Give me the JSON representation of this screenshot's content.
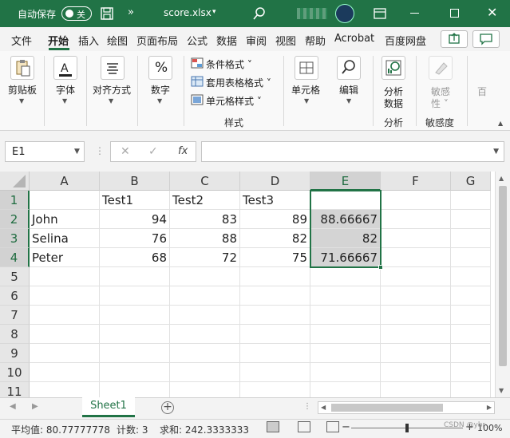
{
  "titlebar": {
    "autosave_label": "自动保存",
    "autosave_state": "关",
    "more": "»",
    "filename": "score.xlsx",
    "caret": "▾"
  },
  "tabs": [
    {
      "label": "文件"
    },
    {
      "label": "开始"
    },
    {
      "label": "插入"
    },
    {
      "label": "绘图"
    },
    {
      "label": "页面布局"
    },
    {
      "label": "公式"
    },
    {
      "label": "数据"
    },
    {
      "label": "审阅"
    },
    {
      "label": "视图"
    },
    {
      "label": "帮助"
    },
    {
      "label": "Acrobat"
    },
    {
      "label": "百度网盘"
    }
  ],
  "ribbon": {
    "clipboard": "剪贴板",
    "font": "字体",
    "align": "对齐方式",
    "number": "数字",
    "cond_format": "条件格式 ˅",
    "table_format": "套用表格格式 ˅",
    "cell_style": "单元格样式 ˅",
    "styles_group": "样式",
    "cells": "单元格",
    "edit": "编辑",
    "analyze_1": "分析",
    "analyze_2": "数据",
    "analyze_group": "分析",
    "sensitivity_1": "敏感",
    "sensitivity_2": "性 ˅",
    "sensitivity_group": "敏感度",
    "number_icon": "%",
    "partial": "百"
  },
  "formula_bar": {
    "name_box": "E1",
    "fx": "fx",
    "value": ""
  },
  "sheet": {
    "columns": [
      "A",
      "B",
      "C",
      "D",
      "E",
      "F",
      "G"
    ],
    "rows": [
      "1",
      "2",
      "3",
      "4",
      "5",
      "6",
      "7",
      "8",
      "9",
      "10",
      "11"
    ],
    "cells": {
      "B1": "Test1",
      "C1": "Test2",
      "D1": "Test3",
      "E1": "",
      "A2": "John",
      "B2": "94",
      "C2": "83",
      "D2": "89",
      "E2": "88.66667",
      "A3": "Selina",
      "B3": "76",
      "C3": "88",
      "D3": "82",
      "E3": "82",
      "A4": "Peter",
      "B4": "68",
      "C4": "72",
      "D4": "75",
      "E4": "71.66667"
    }
  },
  "sheet_tabs": {
    "active": "Sheet1",
    "add": "+",
    "dots": "⋮"
  },
  "status": {
    "average": "平均值: 80.77777778",
    "count": "计数: 3",
    "sum": "求和: 242.3333333",
    "zoom_minus": "−",
    "zoom_plus": "+",
    "zoom": "100%",
    "watermark": "CSDN @ybr"
  },
  "colors": {
    "brand": "#217346",
    "selection": "#d4d4d4"
  },
  "icons": [
    "save-icon",
    "search-icon",
    "avatar",
    "ribbon-display-icon",
    "minimize-icon",
    "maximize-icon",
    "close-icon",
    "share-icon",
    "comment-icon",
    "paste-icon",
    "font-icon",
    "align-icon",
    "percent-icon",
    "conditional-format-icon",
    "table-format-icon",
    "cell-style-icon",
    "cells-icon",
    "find-icon",
    "analyze-data-icon",
    "sensitivity-icon"
  ]
}
